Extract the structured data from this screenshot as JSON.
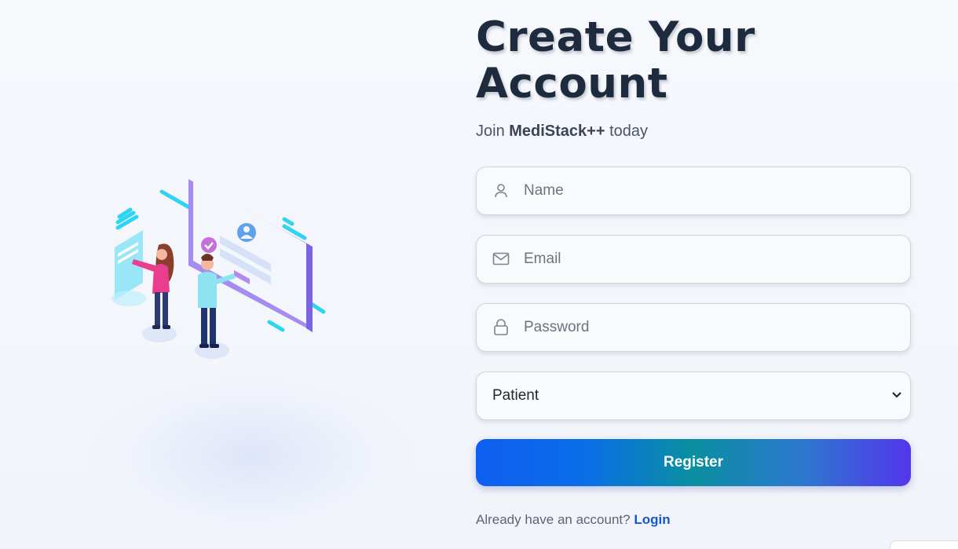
{
  "header": {
    "title": "Create Your\nAccount",
    "subtitle_prefix": "Join ",
    "subtitle_brand": "MediStack++",
    "subtitle_suffix": " today"
  },
  "form": {
    "name_placeholder": "Name",
    "email_placeholder": "Email",
    "password_placeholder": "Password",
    "role_selected": "Patient",
    "register_label": "Register"
  },
  "footer": {
    "question": "Already have an account?",
    "login_link": "Login"
  },
  "icons": {
    "name": "user-icon",
    "email": "mail-icon",
    "password": "lock-icon",
    "select": "chevron-down-icon"
  },
  "colors": {
    "heading": "#1e2a3d",
    "link": "#1357d6",
    "button_gradient_start": "#0f5ef0",
    "button_gradient_end": "#5336ec"
  }
}
